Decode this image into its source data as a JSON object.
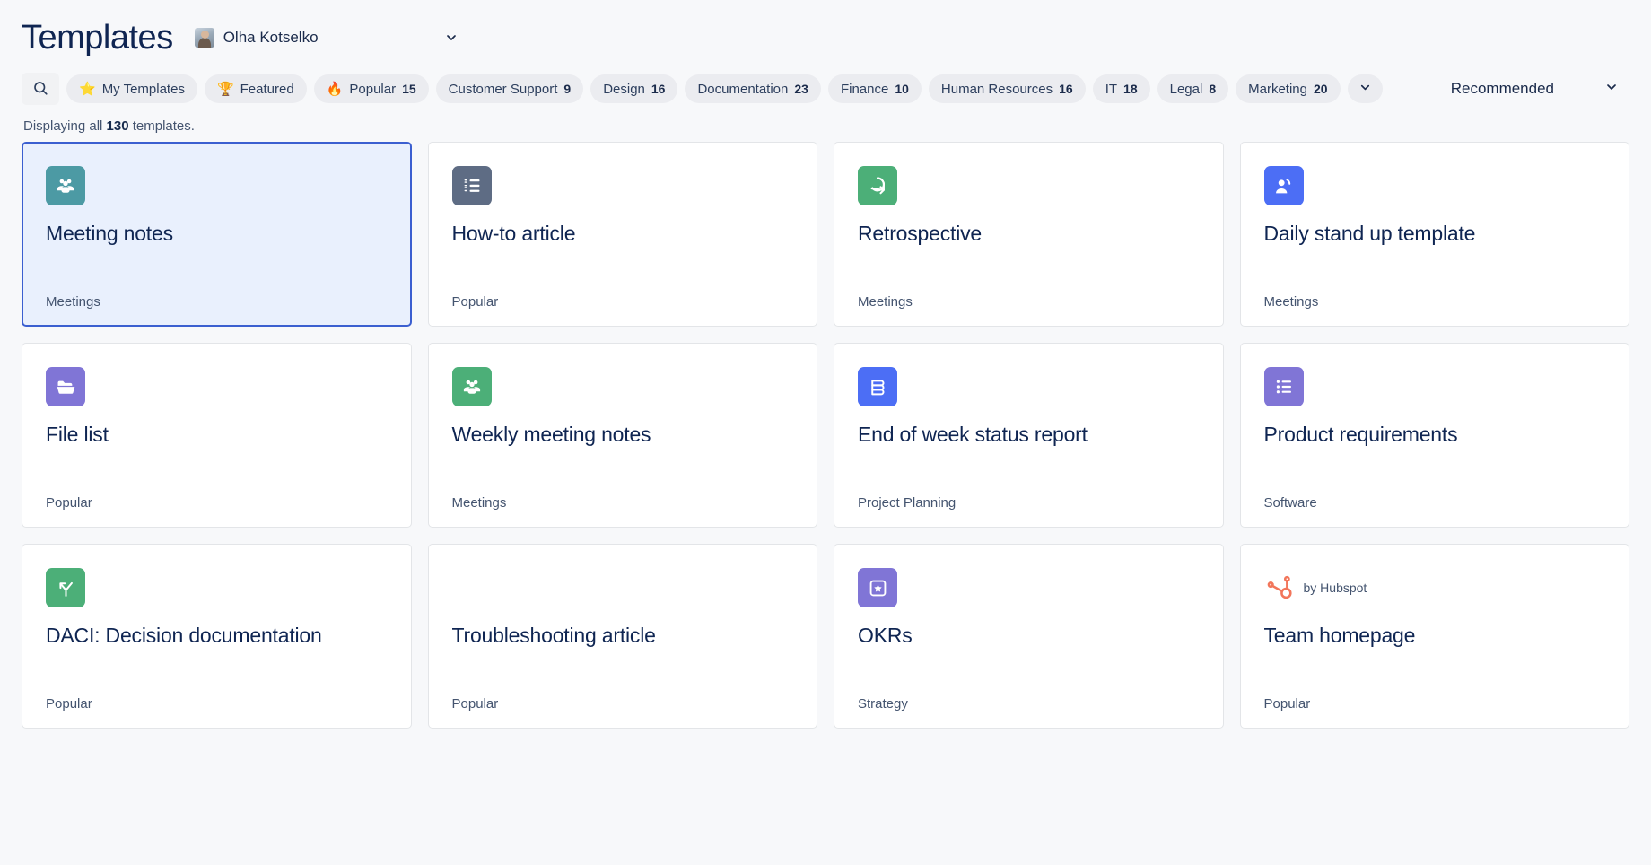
{
  "header": {
    "title": "Templates",
    "owner_name": "Olha Kotselko",
    "avatar_icon": "user-avatar",
    "caret_icon": "chevron-down-icon"
  },
  "filters": {
    "search_icon": "search-icon",
    "chips": [
      {
        "label": "My Templates",
        "count": "",
        "icon": "star-icon",
        "emoji": "⭐"
      },
      {
        "label": "Featured",
        "count": "",
        "icon": "trophy-icon",
        "emoji": "🏆"
      },
      {
        "label": "Popular",
        "count": "15",
        "icon": "fire-icon",
        "emoji": "🔥"
      },
      {
        "label": "Customer Support",
        "count": "9",
        "icon": "",
        "emoji": ""
      },
      {
        "label": "Design",
        "count": "16",
        "icon": "",
        "emoji": ""
      },
      {
        "label": "Documentation",
        "count": "23",
        "icon": "",
        "emoji": ""
      },
      {
        "label": "Finance",
        "count": "10",
        "icon": "",
        "emoji": ""
      },
      {
        "label": "Human Resources",
        "count": "16",
        "icon": "",
        "emoji": ""
      },
      {
        "label": "IT",
        "count": "18",
        "icon": "",
        "emoji": ""
      },
      {
        "label": "Legal",
        "count": "8",
        "icon": "",
        "emoji": ""
      },
      {
        "label": "Marketing",
        "count": "20",
        "icon": "",
        "emoji": ""
      }
    ],
    "more_icon": "chevron-down-icon",
    "sort": {
      "value": "Recommended",
      "caret_icon": "chevron-down-icon"
    }
  },
  "results": {
    "prefix": "Displaying all ",
    "count": "130",
    "suffix": " templates."
  },
  "colors": {
    "accent": "#3b5fd0",
    "selected_bg": "#e9f0fd",
    "page_bg": "#f7f8fa",
    "chip_bg": "#ebecf0",
    "card_bg": "#ffffff",
    "text": "#0f2552",
    "muted_text": "#44546f"
  },
  "cards": [
    {
      "title": "Meeting notes",
      "category": "Meetings",
      "icon": "people-group-icon",
      "tile_color": "#4c9aa4",
      "selected": true,
      "brand": ""
    },
    {
      "title": "How-to article",
      "category": "Popular",
      "icon": "ordered-list-icon",
      "tile_color": "#5e6c84",
      "selected": false,
      "brand": ""
    },
    {
      "title": "Retrospective",
      "category": "Meetings",
      "icon": "retrospective-loop-icon",
      "tile_color": "#4caf78",
      "selected": false,
      "brand": ""
    },
    {
      "title": "Daily stand up template",
      "category": "Meetings",
      "icon": "person-speaking-icon",
      "tile_color": "#4c6ef5",
      "selected": false,
      "brand": ""
    },
    {
      "title": "File list",
      "category": "Popular",
      "icon": "open-folder-icon",
      "tile_color": "#8075d6",
      "selected": false,
      "brand": ""
    },
    {
      "title": "Weekly meeting notes",
      "category": "Meetings",
      "icon": "people-group-icon",
      "tile_color": "#4caf78",
      "selected": false,
      "brand": ""
    },
    {
      "title": "End of week status report",
      "category": "Project Planning",
      "icon": "document-stack-icon",
      "tile_color": "#4c6ef5",
      "selected": false,
      "brand": ""
    },
    {
      "title": "Product requirements",
      "category": "Software",
      "icon": "bullet-list-icon",
      "tile_color": "#8075d6",
      "selected": false,
      "brand": ""
    },
    {
      "title": "DACI: Decision documentation",
      "category": "Popular",
      "icon": "decision-fork-icon",
      "tile_color": "#4caf78",
      "selected": false,
      "brand": ""
    },
    {
      "title": "Troubleshooting article",
      "category": "Popular",
      "icon": "bug-icon",
      "tile_color": "#e25c३b",
      "selected": false,
      "brand": ""
    },
    {
      "title": "OKRs",
      "category": "Strategy",
      "icon": "star-badge-icon",
      "tile_color": "#8075d6",
      "selected": false,
      "brand": ""
    },
    {
      "title": "Team homepage",
      "category": "Popular",
      "icon": "hubspot-logo-icon",
      "tile_color": "",
      "selected": false,
      "brand": "by Hubspot"
    }
  ]
}
